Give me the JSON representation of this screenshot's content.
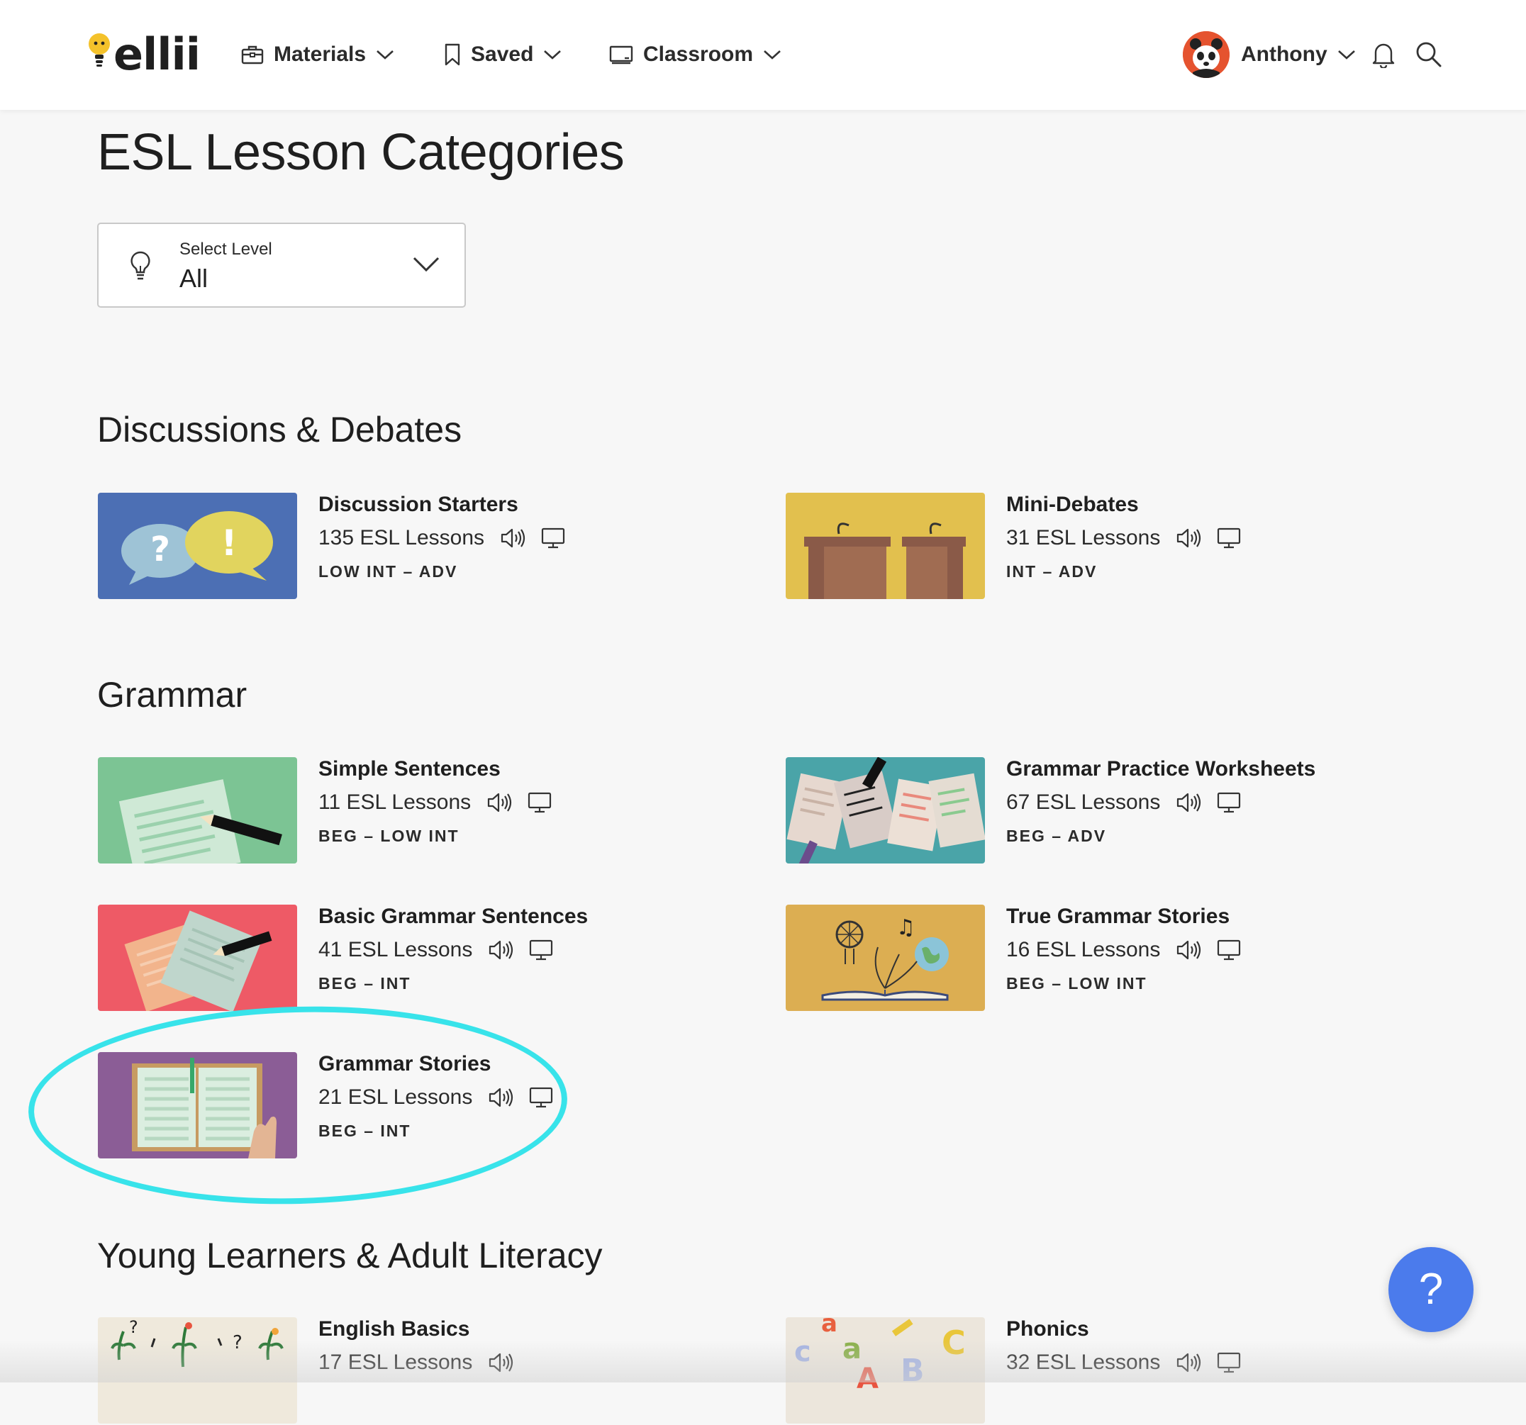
{
  "header": {
    "logo_text": "ellii",
    "nav": [
      {
        "label": "Materials",
        "icon": "briefcase-icon"
      },
      {
        "label": "Saved",
        "icon": "bookmark-icon"
      },
      {
        "label": "Classroom",
        "icon": "classroom-board-icon"
      }
    ],
    "user_name": "Anthony"
  },
  "page_title": "ESL Lesson Categories",
  "level_select": {
    "caption": "Select Level",
    "value": "All"
  },
  "sections": [
    {
      "title": "Discussions & Debates",
      "cards": [
        {
          "name": "Discussion Starters",
          "count": "135 ESL Lessons",
          "level": "LOW INT – ADV",
          "audio": true,
          "screen": true
        },
        {
          "name": "Mini-Debates",
          "count": "31 ESL Lessons",
          "level": "INT – ADV",
          "audio": true,
          "screen": true
        }
      ]
    },
    {
      "title": "Grammar",
      "cards": [
        {
          "name": "Simple Sentences",
          "count": "11 ESL Lessons",
          "level": "BEG – LOW INT",
          "audio": true,
          "screen": true
        },
        {
          "name": "Grammar Practice Worksheets",
          "count": "67 ESL Lessons",
          "level": "BEG – ADV",
          "audio": true,
          "screen": true
        },
        {
          "name": "Basic Grammar Sentences",
          "count": "41 ESL Lessons",
          "level": "BEG – INT",
          "audio": true,
          "screen": true
        },
        {
          "name": "True Grammar Stories",
          "count": "16 ESL Lessons",
          "level": "BEG – LOW INT",
          "audio": true,
          "screen": true
        },
        {
          "name": "Grammar Stories",
          "count": "21 ESL Lessons",
          "level": "BEG – INT",
          "audio": true,
          "screen": true
        }
      ]
    },
    {
      "title": "Young Learners & Adult Literacy",
      "cards": [
        {
          "name": "English Basics",
          "count": "17 ESL Lessons",
          "audio": true,
          "screen": false
        },
        {
          "name": "Phonics",
          "count": "32 ESL Lessons",
          "audio": true,
          "screen": true
        }
      ]
    }
  ],
  "help_button": "?",
  "colors": {
    "highlight": "#38e3ea",
    "help_button": "#4b7bec",
    "thumb_discussion": "#4c6fb4",
    "thumb_debates": "#e2c04e",
    "thumb_simple": "#7cc494",
    "thumb_worksheets": "#4aa4a8",
    "thumb_basic": "#ee5a66",
    "thumb_true_stories": "#dcae52",
    "thumb_grammar_stories": "#8b5d96"
  }
}
